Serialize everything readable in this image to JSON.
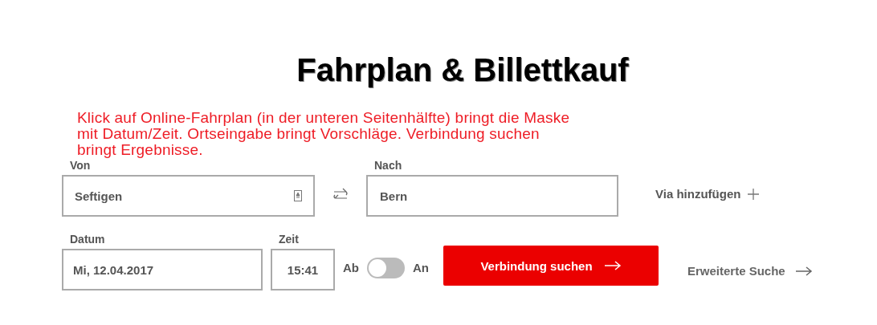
{
  "title": "Fahrplan & Billettkauf",
  "annotation_lines": [
    "Klick auf Online-Fahrplan (in der unteren Seitenhälfte) bringt die Maske",
    "mit Datum/Zeit. Ortseingabe bringt Vorschläge. Verbindung suchen",
    "bringt Ergebnisse."
  ],
  "from": {
    "label": "Von",
    "value": "Seftigen"
  },
  "to": {
    "label": "Nach",
    "value": "Bern"
  },
  "via_link": "Via hinzufügen",
  "date": {
    "label": "Datum",
    "value": "Mi, 12.04.2017"
  },
  "time": {
    "label": "Zeit",
    "value": "15:41"
  },
  "toggle": {
    "off_label": "Ab",
    "on_label": "An",
    "on": false
  },
  "search_button": "Verbindung suchen",
  "advanced_link": "Erweiterte Suche"
}
